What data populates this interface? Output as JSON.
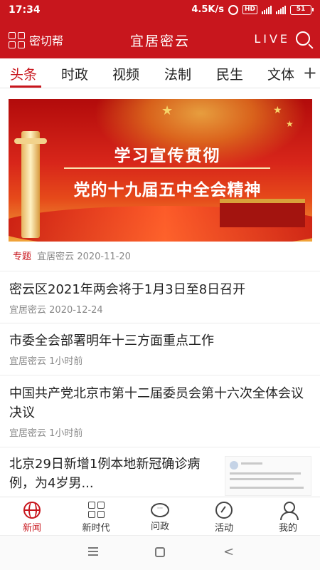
{
  "status_bar": {
    "time": "17:34",
    "speed": "4.5K/s",
    "network": "HD",
    "battery": "51"
  },
  "app_bar": {
    "menu_label": "密切帮",
    "title": "宜居密云",
    "live_label": "LIVE"
  },
  "tabs": [
    {
      "label": "头条",
      "active": true
    },
    {
      "label": "时政",
      "active": false
    },
    {
      "label": "视频",
      "active": false
    },
    {
      "label": "法制",
      "active": false
    },
    {
      "label": "民生",
      "active": false
    },
    {
      "label": "文体",
      "active": false
    }
  ],
  "tabs_more": "+",
  "banner": {
    "line1": "学习宣传贯彻",
    "line2": "党的十九届五中全会精神",
    "tag": "专题",
    "source": "宜居密云",
    "date": "2020-11-20"
  },
  "news": [
    {
      "title": "密云区2021年两会将于1月3日至8日召开",
      "source": "宜居密云",
      "time": "2020-12-24"
    },
    {
      "title": "市委全会部署明年十三方面重点工作",
      "source": "宜居密云",
      "time": "1小时前"
    },
    {
      "title": "中国共产党北京市第十二届委员会第十六次全体会议决议",
      "source": "宜居密云",
      "time": "1小时前"
    },
    {
      "title": "北京29日新增1例本地新冠确诊病例，为4岁男...",
      "source": "",
      "time": ""
    }
  ],
  "bottom_nav": [
    {
      "label": "新闻",
      "icon": "globe-icon",
      "active": true
    },
    {
      "label": "新时代",
      "icon": "grid-icon",
      "active": false
    },
    {
      "label": "问政",
      "icon": "chat-bubble-icon",
      "active": false
    },
    {
      "label": "活动",
      "icon": "gauge-icon",
      "active": false
    },
    {
      "label": "我的",
      "icon": "person-icon",
      "active": false
    }
  ],
  "colors": {
    "brand": "#c8161d",
    "meta": "#888888"
  }
}
